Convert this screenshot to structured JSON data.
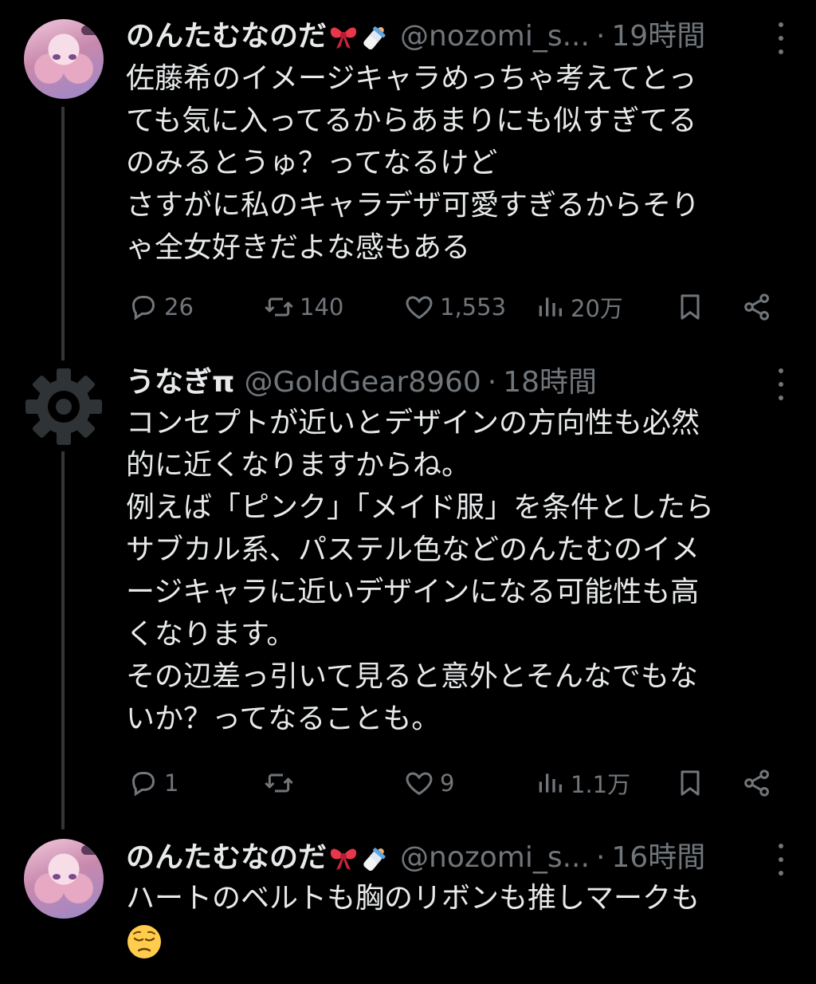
{
  "tweets": [
    {
      "name": "のんたむなのだ",
      "name_emoji": [
        "ribbon-emoji",
        "baby-bottle-emoji"
      ],
      "handle": "@nozomi_s...",
      "separator": "·",
      "time": "19時間",
      "lines": [
        "佐藤希のイメージキャラめっちゃ考えてとっ",
        "ても気に入ってるからあまりにも似すぎてる",
        "のみるとうゅ？ってなるけど",
        "さすがに私のキャラデザ可愛すぎるからそり",
        "ゃ全女好きだよな感もある"
      ],
      "replies": "26",
      "reposts": "140",
      "likes": "1,553",
      "views": "20万"
    },
    {
      "name": "うなぎπ",
      "handle": "@GoldGear8960",
      "separator": "·",
      "time": "18時間",
      "lines": [
        "コンセプトが近いとデザインの方向性も必然",
        "的に近くなりますからね。",
        "例えば「ピンク」「メイド服」を条件としたら",
        "サブカル系、パステル色などのんたむのイメ",
        "ージキャラに近いデザインになる可能性も高",
        "くなります。",
        "その辺差っ引いて見ると意外とそんなでもな",
        "いか？ってなることも。"
      ],
      "replies": "1",
      "reposts": "",
      "likes": "9",
      "views": "1.1万"
    },
    {
      "name": "のんたむなのだ",
      "name_emoji": [
        "ribbon-emoji",
        "baby-bottle-emoji"
      ],
      "handle": "@nozomi_s...",
      "separator": "·",
      "time": "16時間",
      "lines": [
        "ハートのベルトも胸のリボンも推しマークも"
      ],
      "trailing_emoji": "pensive-face-emoji"
    }
  ],
  "colors": {
    "background": "#000000",
    "text": "#e7e9ea",
    "muted": "#71767b",
    "thread_line": "#333639"
  }
}
